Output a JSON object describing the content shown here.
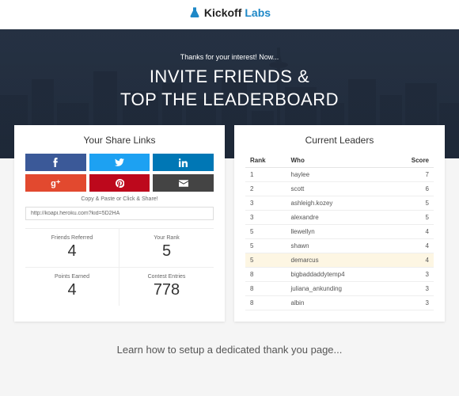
{
  "logo": {
    "kickoff": "Kickoff",
    "labs": "Labs"
  },
  "hero": {
    "subtitle": "Thanks for your interest! Now...",
    "title_line1": "INVITE FRIENDS &",
    "title_line2": "TOP THE LEADERBOARD"
  },
  "share": {
    "title": "Your Share Links",
    "copy_label": "Copy & Paste or Click & Share!",
    "url": "http://koapi.heroku.com?kid=5D2HA"
  },
  "stats": [
    {
      "label": "Friends Referred",
      "value": "4"
    },
    {
      "label": "Your Rank",
      "value": "5"
    },
    {
      "label": "Points Earned",
      "value": "4"
    },
    {
      "label": "Contest Entries",
      "value": "778"
    }
  ],
  "leaders": {
    "title": "Current Leaders",
    "cols": {
      "rank": "Rank",
      "who": "Who",
      "score": "Score"
    },
    "rows": [
      {
        "rank": "1",
        "who": "haylee",
        "score": "7",
        "me": false
      },
      {
        "rank": "2",
        "who": "scott",
        "score": "6",
        "me": false
      },
      {
        "rank": "3",
        "who": "ashleigh.kozey",
        "score": "5",
        "me": false
      },
      {
        "rank": "3",
        "who": "alexandre",
        "score": "5",
        "me": false
      },
      {
        "rank": "5",
        "who": "llewellyn",
        "score": "4",
        "me": false
      },
      {
        "rank": "5",
        "who": "shawn",
        "score": "4",
        "me": false
      },
      {
        "rank": "5",
        "who": "demarcus",
        "score": "4",
        "me": true
      },
      {
        "rank": "8",
        "who": "bigbaddaddytemp4",
        "score": "3",
        "me": false
      },
      {
        "rank": "8",
        "who": "juliana_ankunding",
        "score": "3",
        "me": false
      },
      {
        "rank": "8",
        "who": "albin",
        "score": "3",
        "me": false
      }
    ]
  },
  "footer": "Learn how to setup a dedicated thank you page...",
  "icons": {
    "facebook": "facebook-icon",
    "twitter": "twitter-icon",
    "linkedin": "linkedin-icon",
    "googleplus": "googleplus-icon",
    "pinterest": "pinterest-icon",
    "email": "email-icon"
  }
}
